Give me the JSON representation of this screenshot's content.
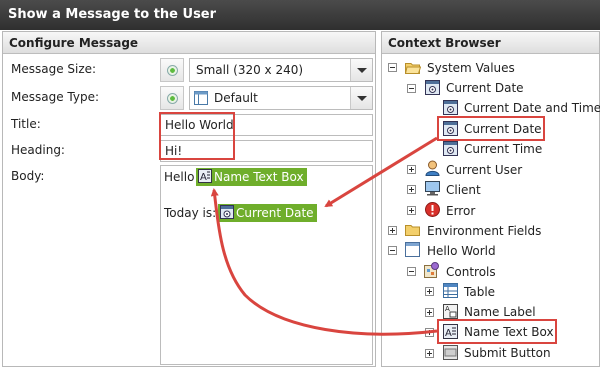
{
  "window": {
    "title": "Show a Message to the User"
  },
  "configure": {
    "header": "Configure Message",
    "size_label": "Message Size:",
    "size_value": "Small (320 x 240)",
    "type_label": "Message Type:",
    "type_value": "Default",
    "title_label": "Title:",
    "title_value": "Hello World",
    "heading_label": "Heading:",
    "heading_value": "Hi!",
    "body_label": "Body:",
    "body": {
      "hello_text": "Hello",
      "chip1": "Name Text Box",
      "today_text": "Today is:",
      "chip2": "Current Date"
    }
  },
  "context": {
    "header": "Context Browser",
    "tree": {
      "system_values": "System Values",
      "current_date_group": "Current Date",
      "current_date_and_time": "Current Date and Time",
      "current_date": "Current Date",
      "current_time": "Current Time",
      "current_user": "Current User",
      "client": "Client",
      "error": "Error",
      "environment_fields": "Environment Fields",
      "hello_world": "Hello World",
      "controls": "Controls",
      "table": "Table",
      "name_label": "Name Label",
      "name_text_box": "Name Text Box",
      "submit_button": "Submit Button"
    }
  },
  "colors": {
    "highlight_red": "#d9453f",
    "chip_green": "#6fae2b",
    "titlebar_dark": "#3a3a3a"
  }
}
